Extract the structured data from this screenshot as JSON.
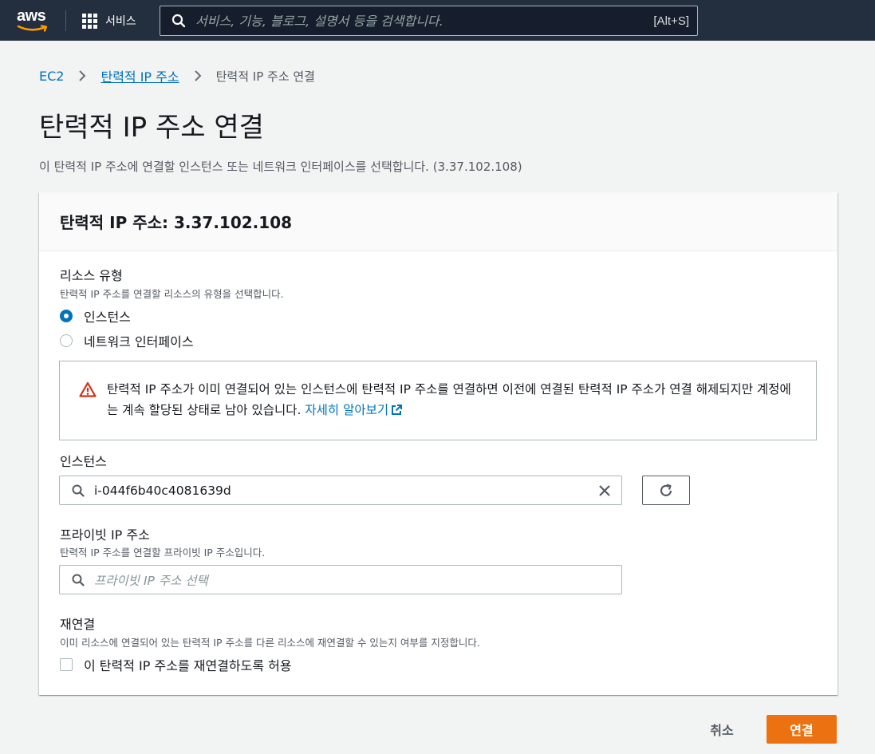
{
  "nav": {
    "logo_text": "aws",
    "services_label": "서비스",
    "search_placeholder": "서비스, 기능, 블로그, 설명서 등을 검색합니다.",
    "search_shortcut": "[Alt+S]"
  },
  "breadcrumb": {
    "root": "EC2",
    "parent": "탄력적 IP 주소",
    "current": "탄력적 IP 주소 연결"
  },
  "page": {
    "title": "탄력적 IP 주소 연결",
    "description": "이 탄력적 IP 주소에 연결할 인스턴스 또는 네트워크 인터페이스를 선택합니다. (3.37.102.108)"
  },
  "card": {
    "header": "탄력적 IP 주소: 3.37.102.108",
    "resource_type": {
      "label": "리소스 유형",
      "description": "탄력적 IP 주소를 연결할 리소스의 유형을 선택합니다.",
      "options": [
        {
          "label": "인스턴스",
          "selected": true
        },
        {
          "label": "네트워크 인터페이스",
          "selected": false
        }
      ]
    },
    "alert": {
      "message": "탄력적 IP 주소가 이미 연결되어 있는 인스턴스에 탄력적 IP 주소를 연결하면 이전에 연결된 탄력적 IP 주소가 연결 해제되지만 계정에는 계속 할당된 상태로 남아 있습니다.",
      "link": "자세히 알아보기"
    },
    "instance": {
      "label": "인스턴스",
      "value": "i-044f6b40c4081639d"
    },
    "private_ip": {
      "label": "프라이빗 IP 주소",
      "description": "탄력적 IP 주소를 연결할 프라이빗 IP 주소입니다.",
      "placeholder": "프라이빗 IP 주소 선택"
    },
    "reassociation": {
      "label": "재연결",
      "description": "이미 리소스에 연결되어 있는 탄력적 IP 주소를 다른 리소스에 재연결할 수 있는지 여부를 지정합니다.",
      "checkbox_label": "이 탄력적 IP 주소를 재연결하도록 허용",
      "checked": false
    }
  },
  "actions": {
    "cancel": "취소",
    "submit": "연결"
  },
  "colors": {
    "nav_bg": "#232f3e",
    "link": "#0073bb",
    "primary": "#ec7211",
    "warning": "#d13212"
  }
}
